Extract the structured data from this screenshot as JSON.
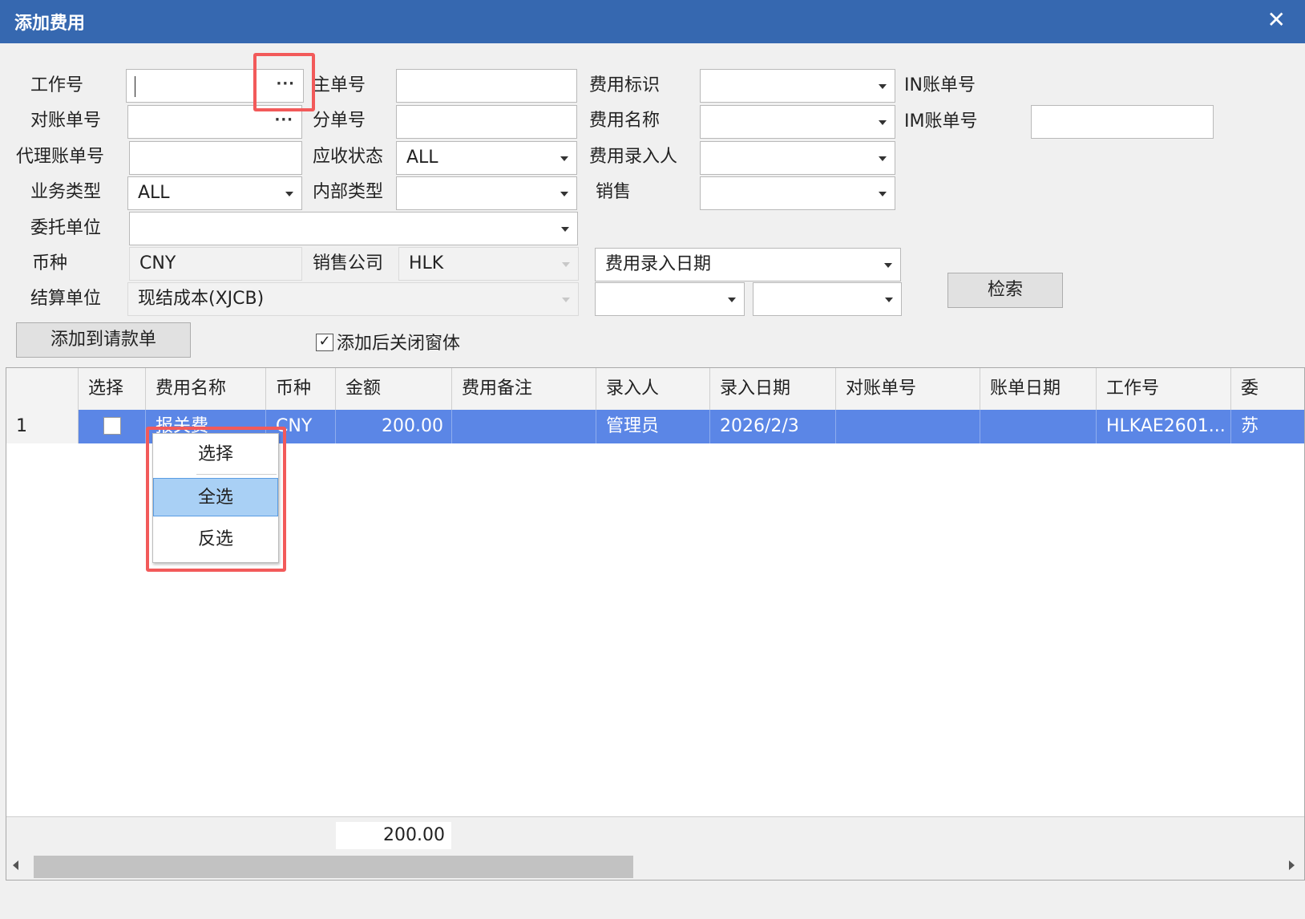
{
  "window": {
    "title": "添加费用",
    "close_glyph": "✕"
  },
  "form": {
    "job_no": {
      "label": "工作号",
      "value": ""
    },
    "main_bill_no": {
      "label": "主单号",
      "value": ""
    },
    "fee_flag": {
      "label": "费用标识",
      "value": ""
    },
    "in_bill_no": {
      "label": "IN账单号"
    },
    "recon_no": {
      "label": "对账单号",
      "value": ""
    },
    "sub_bill_no": {
      "label": "分单号",
      "value": ""
    },
    "fee_name": {
      "label": "费用名称",
      "value": ""
    },
    "im_bill_no": {
      "label": "IM账单号",
      "value": ""
    },
    "agent_bill_no": {
      "label": "代理账单号",
      "value": ""
    },
    "receivable_status": {
      "label": "应收状态",
      "value": "ALL"
    },
    "fee_entry_person": {
      "label": "费用录入人",
      "value": ""
    },
    "business_type": {
      "label": "业务类型",
      "value": "ALL"
    },
    "internal_type": {
      "label": "内部类型",
      "value": ""
    },
    "sales": {
      "label": "销售",
      "value": ""
    },
    "consignor": {
      "label": "委托单位",
      "value": ""
    },
    "currency": {
      "label": "币种",
      "value": "CNY"
    },
    "sales_company": {
      "label": "销售公司",
      "value": "HLK"
    },
    "settlement_unit": {
      "label": "结算单位",
      "value": "现结成本(XJCB)"
    },
    "date_type": {
      "value": "费用录入日期"
    },
    "date_from": {
      "value": ""
    },
    "date_to": {
      "value": ""
    },
    "ellipsis": "···"
  },
  "buttons": {
    "search": "检索",
    "add_to_request": "添加到请款单"
  },
  "close_after_add": {
    "label": "添加后关闭窗体",
    "checked": true,
    "glyph": "✓"
  },
  "grid": {
    "columns": [
      "",
      "选择",
      "费用名称",
      "币种",
      "金额",
      "费用备注",
      "录入人",
      "录入日期",
      "对账单号",
      "账单日期",
      "工作号",
      "委"
    ],
    "rows": [
      {
        "row_no": "1",
        "select": false,
        "fee_name": "报关费",
        "currency": "CNY",
        "amount": "200.00",
        "fee_note": "",
        "entered_by": "管理员",
        "entry_date": "2026/2/3",
        "recon_no": "",
        "bill_date": "",
        "job_no": "HLKAE2601...",
        "consignor": "苏"
      }
    ],
    "total_amount": "200.00"
  },
  "context_menu": {
    "items": [
      "选择",
      "全选",
      "反选"
    ],
    "highlighted": "全选"
  },
  "colors": {
    "titlebar": "#3668b0",
    "selected_row": "#5b86e6",
    "highlight_box": "#f25a5a",
    "menu_highlight": "#a9d0f5"
  }
}
